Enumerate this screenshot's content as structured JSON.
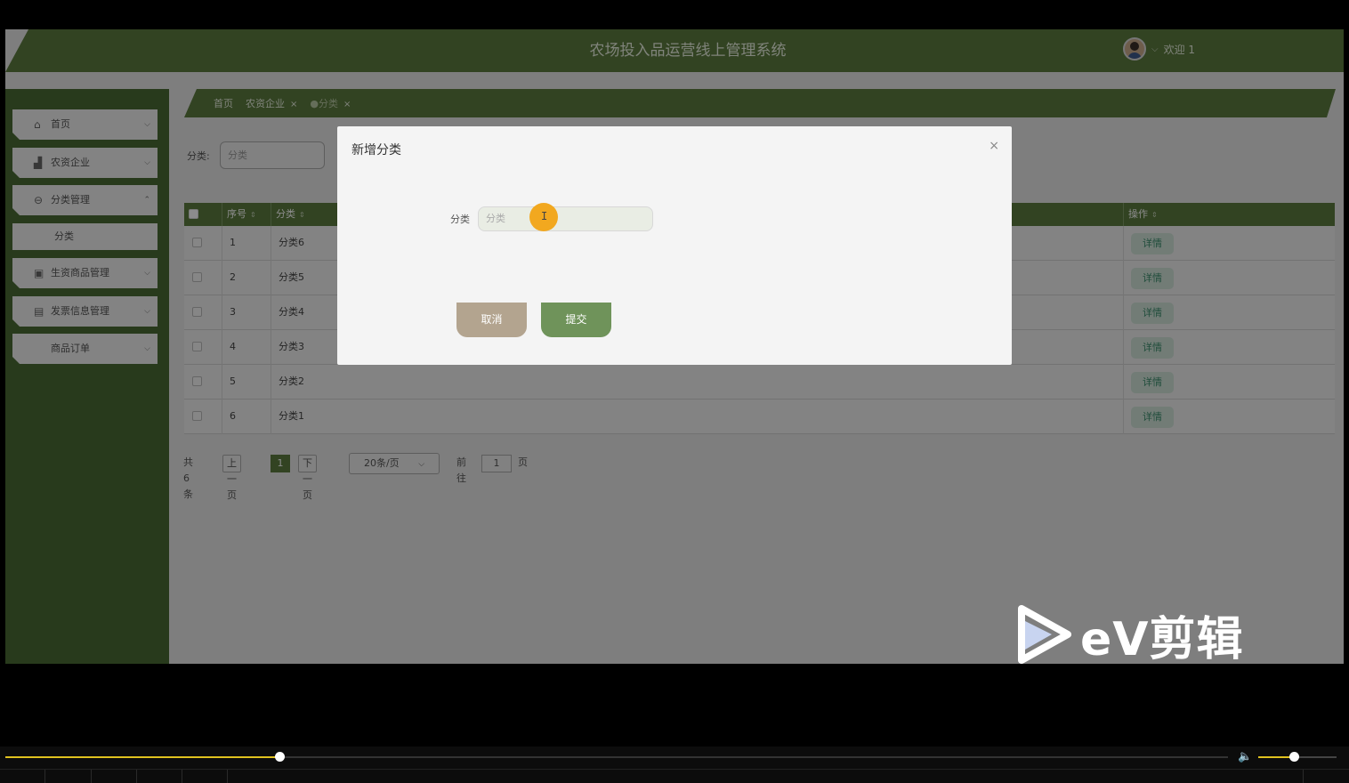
{
  "header": {
    "title": "农场投入品运营线上管理系统",
    "welcome": "欢迎 1"
  },
  "sidebar": {
    "items": [
      {
        "label": "首页",
        "icon": "home-icon"
      },
      {
        "label": "农资企业",
        "icon": "chart-icon"
      },
      {
        "label": "分类管理",
        "icon": "more-dots-icon",
        "expanded": true
      },
      {
        "label": "生资商品管理",
        "icon": "chip-icon"
      },
      {
        "label": "发票信息管理",
        "icon": "store-icon"
      },
      {
        "label": "商品订单",
        "icon": ""
      }
    ],
    "sub_item": "分类"
  },
  "breadcrumbs": [
    {
      "label": "首页",
      "closable": false
    },
    {
      "label": "农资企业",
      "closable": true
    },
    {
      "label": "●分类",
      "closable": true,
      "active": true
    }
  ],
  "search": {
    "label": "分类:",
    "placeholder": "分类"
  },
  "table": {
    "columns": [
      "序号",
      "分类",
      "操作"
    ],
    "rows": [
      {
        "index": "1",
        "category": "分类6"
      },
      {
        "index": "2",
        "category": "分类5"
      },
      {
        "index": "3",
        "category": "分类4"
      },
      {
        "index": "4",
        "category": "分类3"
      },
      {
        "index": "5",
        "category": "分类2"
      },
      {
        "index": "6",
        "category": "分类1"
      }
    ],
    "action_label": "详情"
  },
  "pagination": {
    "total": "共 6 条",
    "prev": "上一页",
    "current": "1",
    "next": "下一页",
    "page_size": "20条/页",
    "goto_label": "前往",
    "goto_value": "1",
    "page_unit": "页"
  },
  "dialog": {
    "title": "新增分类",
    "close": "×",
    "field_label": "分类",
    "field_placeholder": "分类",
    "cancel": "取消",
    "submit": "提交"
  },
  "watermark": {
    "text": "eV剪辑"
  },
  "player": {
    "progress": 0.224,
    "volume": 0.45
  },
  "colors": {
    "primary": "#5b7a3e",
    "sidebar": "#4a6a33",
    "cancel": "#b3a48f",
    "submit": "#6f935a",
    "progress": "#e0c21f"
  }
}
